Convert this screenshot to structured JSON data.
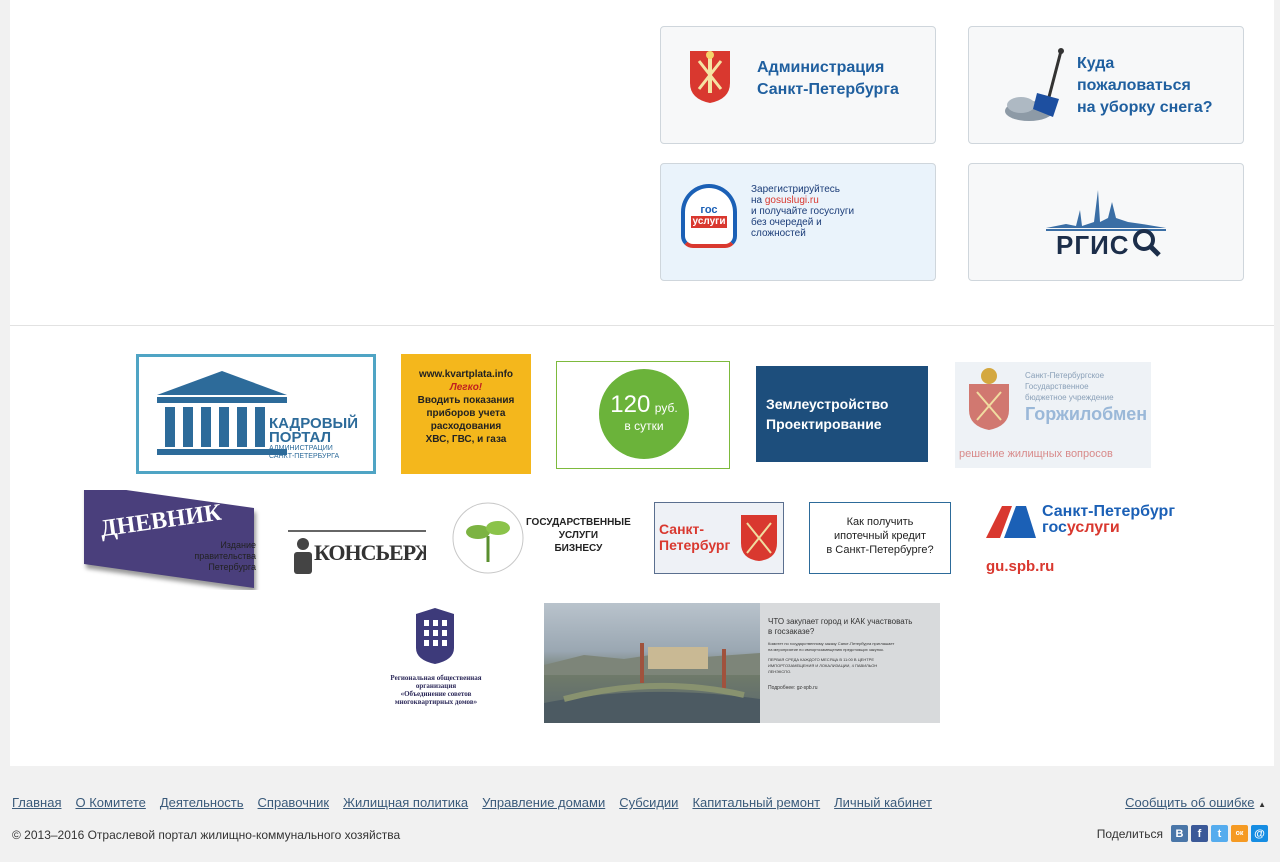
{
  "cards": {
    "admin": {
      "line1": "Администрация",
      "line2": "Санкт-Петербурга"
    },
    "snow": {
      "line1": "Куда",
      "line2": "пожаловаться",
      "line3": "на уборку снега?"
    },
    "gosuslugi": {
      "logo1": "гос",
      "logo2": "услуги",
      "l1": "Зарегистрируйтесь",
      "l2a": "на ",
      "l2b": "gosuslugi.ru",
      "l3": "и получайте госуслуги",
      "l4": "без очередей и",
      "l5": "сложностей"
    },
    "rgis": {
      "logo": "РГИС"
    }
  },
  "banners": {
    "kadr": {
      "l1": "КАДРОВЫЙ",
      "l2": "ПОРТАЛ",
      "l3": "АДМИНИСТРАЦИИ",
      "l4": "САНКТ-ПЕТЕРБУРГА"
    },
    "kvartplata": {
      "l1": "www.kvartplata.info",
      "l2": "Легко!",
      "l3": "Вводить показания",
      "l4": "приборов учета",
      "l5": "расходования",
      "l6": "ХВС, ГВС, и газа"
    },
    "p120": {
      "l1": "120",
      "l1b": "руб.",
      "l2": "в сутки"
    },
    "zemle": {
      "l1": "Землеустройство",
      "l2": "Проектирование"
    },
    "gorzh": {
      "l1": "Санкт-Петербургское",
      "l2": "Государственное",
      "l3": "бюджетное учреждение",
      "l4": "Горжилобмен",
      "l5": "решение жилищных вопросов"
    },
    "dnevnik": {
      "title": "ДНЕВНИК",
      "l1": "Издание",
      "l2": "правительства",
      "l3": "Петербурга"
    },
    "konsierge": {
      "title": "КОНСЬЕРЖЪ"
    },
    "business": {
      "l1": "ГОСУДАРСТВЕННЫЕ",
      "l2": "УСЛУГИ",
      "l3": "БИЗНЕСУ"
    },
    "spb": {
      "l1": "Санкт-",
      "l2": "Петербург"
    },
    "credit": {
      "l1": "Как получить",
      "l2": "ипотечный кредит",
      "l3": "в Санкт-Петербурге?"
    },
    "spbgos": {
      "l1": "Санкт-Петербург",
      "l2a": "гос",
      "l2b": "услуги",
      "url": "gu.spb.ru"
    },
    "obed": {
      "l1": "Региональная общественная",
      "l2": "организация",
      "l3": "«Объединение советов",
      "l4": "многоквартирных домов»"
    },
    "goszakaz": {
      "h1": "ЧТО закупает город и КАК участвовать",
      "h2": "в госзаказе?",
      "t1": "Комитет по государственному заказу Санкт-Петербурга приглашает",
      "t2": "на мероприятие по импортозамещению предстоящих закупок.",
      "t3": "ПЕРВАЯ СРЕДА КАЖДОГО МЕСЯЦА В 11:00 В ЦЕНТРЕ",
      "t4": "ИМПОРТОЗАМЕЩЕНИЯ И ЛОКАЛИЗАЦИИ, 4 ПАВИЛЬОН",
      "t5": "ЛЕНЭКСПО.",
      "more": "Подробнее: gz-spb.ru"
    }
  },
  "footer": {
    "nav": [
      "Главная",
      "О Комитете",
      "Деятельность",
      "Справочник",
      "Жилищная политика",
      "Управление домами",
      "Субсидии",
      "Капитальный ремонт",
      "Личный кабинет"
    ],
    "report": "Сообщить об ошибке",
    "copyright": "© 2013–2016 Отраслевой портал жилищно-коммунального хозяйства",
    "share": "Поделиться",
    "social": [
      {
        "icon": "vk-icon",
        "glyph": "В",
        "color": "#4a76a8"
      },
      {
        "icon": "facebook-icon",
        "glyph": "f",
        "color": "#3b5998"
      },
      {
        "icon": "twitter-icon",
        "glyph": "t",
        "color": "#55acee"
      },
      {
        "icon": "odnoklassniki-icon",
        "glyph": "ок",
        "color": "#f59a23"
      },
      {
        "icon": "mailru-icon",
        "glyph": "@",
        "color": "#168de2"
      }
    ]
  }
}
